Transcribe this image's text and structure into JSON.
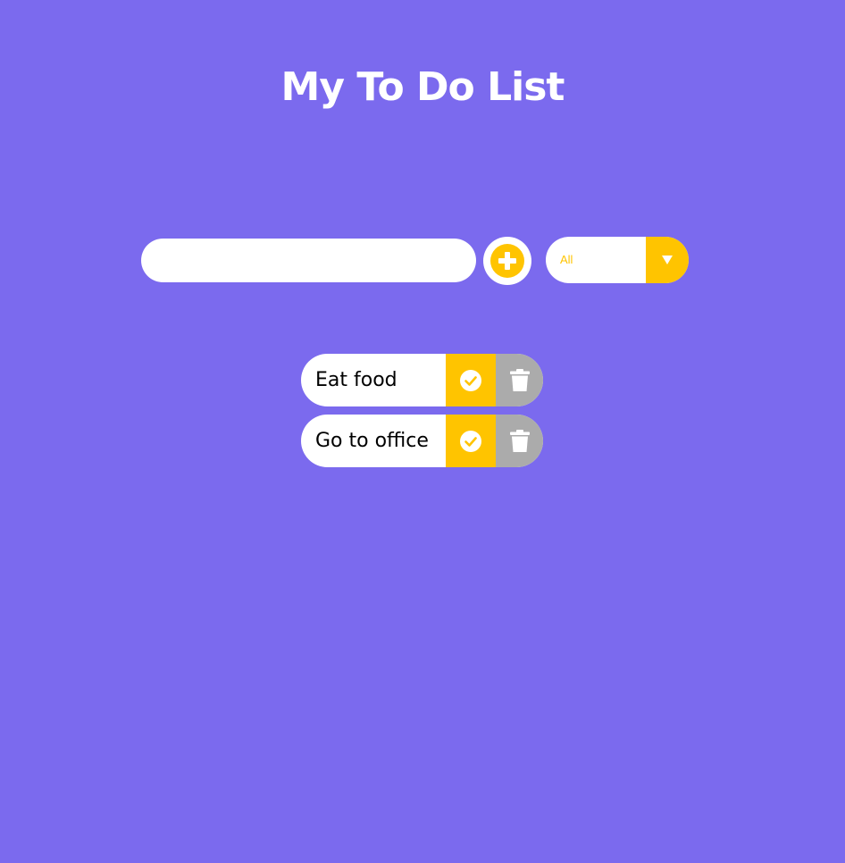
{
  "header": {
    "title": "My To Do List"
  },
  "form": {
    "input_value": "",
    "input_placeholder": "",
    "add_icon": "plus-circle-icon",
    "filter": {
      "selected": "All",
      "arrow_icon": "triangle-down-icon"
    }
  },
  "todos": [
    {
      "text": "Eat food",
      "complete_icon": "check-circle-icon",
      "delete_icon": "trash-icon"
    },
    {
      "text": "Go to office",
      "complete_icon": "check-circle-icon",
      "delete_icon": "trash-icon"
    }
  ],
  "colors": {
    "background": "#7b6aee",
    "accent": "#ffc400",
    "delete": "#ababab",
    "surface": "#ffffff"
  }
}
